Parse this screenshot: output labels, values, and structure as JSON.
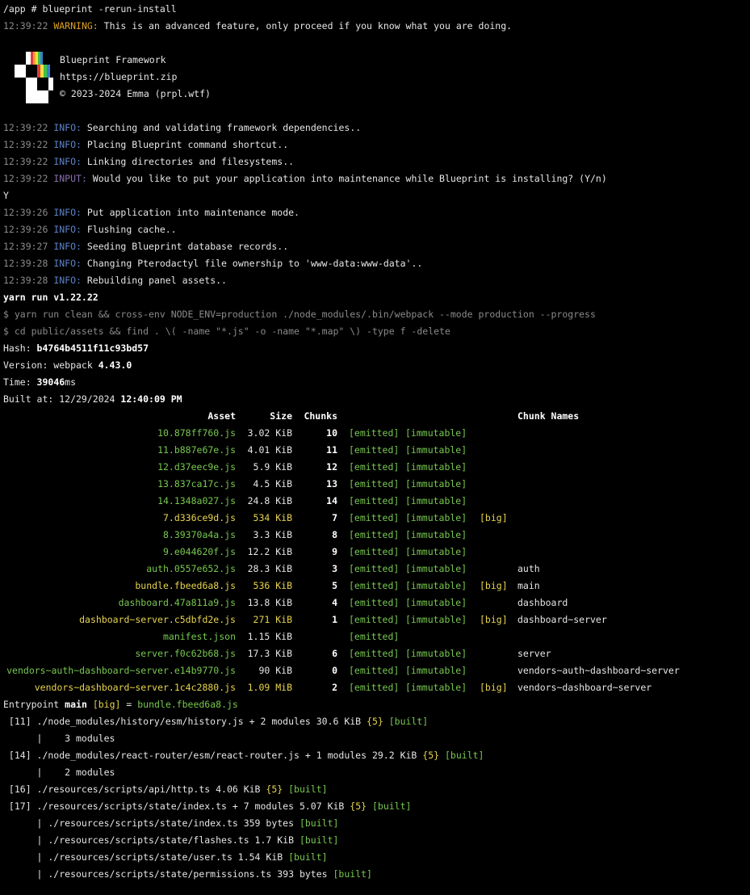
{
  "prompt": "/app # blueprint -rerun-install",
  "warning": {
    "time": "12:39:22",
    "tag": "WARNING:",
    "text": " This is an advanced feature, only proceed if you know what you are doing."
  },
  "brand": {
    "name": "Blueprint Framework",
    "url": "https://blueprint.zip",
    "copyright": "© 2023-2024 Emma (prpl.wtf)"
  },
  "log": [
    {
      "time": "12:39:22",
      "tag": "INFO:",
      "kind": "info",
      "text": " Searching and validating framework dependencies.."
    },
    {
      "time": "12:39:22",
      "tag": "INFO:",
      "kind": "info",
      "text": " Placing Blueprint command shortcut.."
    },
    {
      "time": "12:39:22",
      "tag": "INFO:",
      "kind": "info",
      "text": " Linking directories and filesystems.."
    },
    {
      "time": "12:39:22",
      "tag": "INPUT:",
      "kind": "input",
      "text": " Would you like to put your application into maintenance while Blueprint is installing? (Y/n)"
    }
  ],
  "answer": "Y",
  "log2": [
    {
      "time": "12:39:26",
      "tag": "INFO:",
      "kind": "info",
      "text": " Put application into maintenance mode."
    },
    {
      "time": "12:39:26",
      "tag": "INFO:",
      "kind": "info",
      "text": " Flushing cache.."
    },
    {
      "time": "12:39:27",
      "tag": "INFO:",
      "kind": "info",
      "text": " Seeding Blueprint database records.."
    },
    {
      "time": "12:39:28",
      "tag": "INFO:",
      "kind": "info",
      "text": " Changing Pterodactyl file ownership to 'www-data:www-data'.."
    },
    {
      "time": "12:39:28",
      "tag": "INFO:",
      "kind": "info",
      "text": " Rebuilding panel assets.."
    }
  ],
  "yarn": "yarn run v1.22.22",
  "cmd1": "$ yarn run clean && cross-env NODE_ENV=production ./node_modules/.bin/webpack --mode production --progress",
  "cmd2": "$ cd public/assets && find . \\( -name \"*.js\" -o -name \"*.map\" \\) -type f -delete",
  "hash": {
    "label": "Hash: ",
    "value": "b4764b4511f11c93bd57"
  },
  "version": {
    "label": "Version: webpack ",
    "value": "4.43.0"
  },
  "time": {
    "label": "Time: ",
    "value": "39046",
    "unit": "ms"
  },
  "built": {
    "label": "Built at: 12/29/2024 ",
    "value": "12:40:09 PM"
  },
  "table": {
    "headers": {
      "asset": "Asset",
      "size": "Size",
      "chunks": "Chunks",
      "names": "Chunk Names"
    },
    "rows": [
      {
        "asset": "10.878ff760.js",
        "size": "3.02 KiB",
        "chunk": "10",
        "emitted": "[emitted]",
        "immutable": "[immutable]",
        "big": "",
        "name": "",
        "hl": false
      },
      {
        "asset": "11.b887e67e.js",
        "size": "4.01 KiB",
        "chunk": "11",
        "emitted": "[emitted]",
        "immutable": "[immutable]",
        "big": "",
        "name": "",
        "hl": false
      },
      {
        "asset": "12.d37eec9e.js",
        "size": "5.9 KiB",
        "chunk": "12",
        "emitted": "[emitted]",
        "immutable": "[immutable]",
        "big": "",
        "name": "",
        "hl": false
      },
      {
        "asset": "13.837ca17c.js",
        "size": "4.5 KiB",
        "chunk": "13",
        "emitted": "[emitted]",
        "immutable": "[immutable]",
        "big": "",
        "name": "",
        "hl": false
      },
      {
        "asset": "14.1348a027.js",
        "size": "24.8 KiB",
        "chunk": "14",
        "emitted": "[emitted]",
        "immutable": "[immutable]",
        "big": "",
        "name": "",
        "hl": false
      },
      {
        "asset": "7.d336ce9d.js",
        "size": "534 KiB",
        "chunk": "7",
        "emitted": "[emitted]",
        "immutable": "[immutable]",
        "big": "[big]",
        "name": "",
        "hl": true
      },
      {
        "asset": "8.39370a4a.js",
        "size": "3.3 KiB",
        "chunk": "8",
        "emitted": "[emitted]",
        "immutable": "[immutable]",
        "big": "",
        "name": "",
        "hl": false
      },
      {
        "asset": "9.e044620f.js",
        "size": "12.2 KiB",
        "chunk": "9",
        "emitted": "[emitted]",
        "immutable": "[immutable]",
        "big": "",
        "name": "",
        "hl": false
      },
      {
        "asset": "auth.0557e652.js",
        "size": "28.3 KiB",
        "chunk": "3",
        "emitted": "[emitted]",
        "immutable": "[immutable]",
        "big": "",
        "name": "auth",
        "hl": false
      },
      {
        "asset": "bundle.fbeed6a8.js",
        "size": "536 KiB",
        "chunk": "5",
        "emitted": "[emitted]",
        "immutable": "[immutable]",
        "big": "[big]",
        "name": "main",
        "hl": true
      },
      {
        "asset": "dashboard.47a811a9.js",
        "size": "13.8 KiB",
        "chunk": "4",
        "emitted": "[emitted]",
        "immutable": "[immutable]",
        "big": "",
        "name": "dashboard",
        "hl": false
      },
      {
        "asset": "dashboard~server.c5dbfd2e.js",
        "size": "271 KiB",
        "chunk": "1",
        "emitted": "[emitted]",
        "immutable": "[immutable]",
        "big": "[big]",
        "name": "dashboard~server",
        "hl": true
      },
      {
        "asset": "manifest.json",
        "size": "1.15 KiB",
        "chunk": "",
        "emitted": "[emitted]",
        "immutable": "",
        "big": "",
        "name": "",
        "hl": false
      },
      {
        "asset": "server.f0c62b68.js",
        "size": "17.3 KiB",
        "chunk": "6",
        "emitted": "[emitted]",
        "immutable": "[immutable]",
        "big": "",
        "name": "server",
        "hl": false
      },
      {
        "asset": "vendors~auth~dashboard~server.e14b9770.js",
        "size": "90 KiB",
        "chunk": "0",
        "emitted": "[emitted]",
        "immutable": "[immutable]",
        "big": "",
        "name": "vendors~auth~dashboard~server",
        "hl": false
      },
      {
        "asset": "vendors~dashboard~server.1c4c2880.js",
        "size": "1.09 MiB",
        "chunk": "2",
        "emitted": "[emitted]",
        "immutable": "[immutable]",
        "big": "[big]",
        "name": "vendors~dashboard~server",
        "hl": true
      }
    ]
  },
  "entrypoint": {
    "label": "Entrypoint ",
    "name": "main",
    "big": "[big]",
    "eq": " = ",
    "file": "bundle.fbeed6a8.js"
  },
  "modules": [
    {
      "text": " [11] ./node_modules/history/esm/history.js + 2 modules 30.6 KiB ",
      "chunk": "{5}",
      "built": " [built]"
    },
    {
      "text": "      |    3 modules",
      "chunk": "",
      "built": ""
    },
    {
      "text": " [14] ./node_modules/react-router/esm/react-router.js + 1 modules 29.2 KiB ",
      "chunk": "{5}",
      "built": " [built]"
    },
    {
      "text": "      |    2 modules",
      "chunk": "",
      "built": ""
    },
    {
      "text": " [16] ./resources/scripts/api/http.ts 4.06 KiB ",
      "chunk": "{5}",
      "built": " [built]"
    },
    {
      "text": " [17] ./resources/scripts/state/index.ts + 7 modules 5.07 KiB ",
      "chunk": "{5}",
      "built": " [built]"
    },
    {
      "text": "      | ./resources/scripts/state/index.ts 359 bytes",
      "chunk": "",
      "built": " [built]"
    },
    {
      "text": "      | ./resources/scripts/state/flashes.ts 1.7 KiB",
      "chunk": "",
      "built": " [built]"
    },
    {
      "text": "      | ./resources/scripts/state/user.ts 1.54 KiB",
      "chunk": "",
      "built": " [built]"
    },
    {
      "text": "      | ./resources/scripts/state/permissions.ts 393 bytes",
      "chunk": "",
      "built": " [built]"
    }
  ]
}
